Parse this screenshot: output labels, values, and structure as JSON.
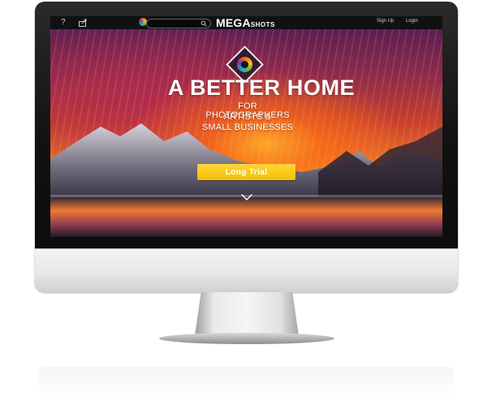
{
  "nav": {
    "help_icon": "?",
    "share_icon": "share-icon",
    "brand_main": "MEGA",
    "brand_sub": "SHOTS",
    "signup": "Sign Up",
    "login": "Login",
    "search_placeholder": ""
  },
  "hero": {
    "emblem_label": "MEGA",
    "headline": "A BETTER HOME",
    "lines": [
      "FOR PHOTOGRAPHERS",
      "ARTISTS &",
      "SMALL BUSINESSES"
    ],
    "cta_label": "Long Trial",
    "scroll_icon": "chevron-down-icon"
  },
  "colors": {
    "cta": "#f5c100",
    "topbar": "#111111",
    "logo_rainbow": [
      "#f26b1d",
      "#f6c514",
      "#62b846",
      "#1ea3dd",
      "#7a3fa0"
    ]
  }
}
